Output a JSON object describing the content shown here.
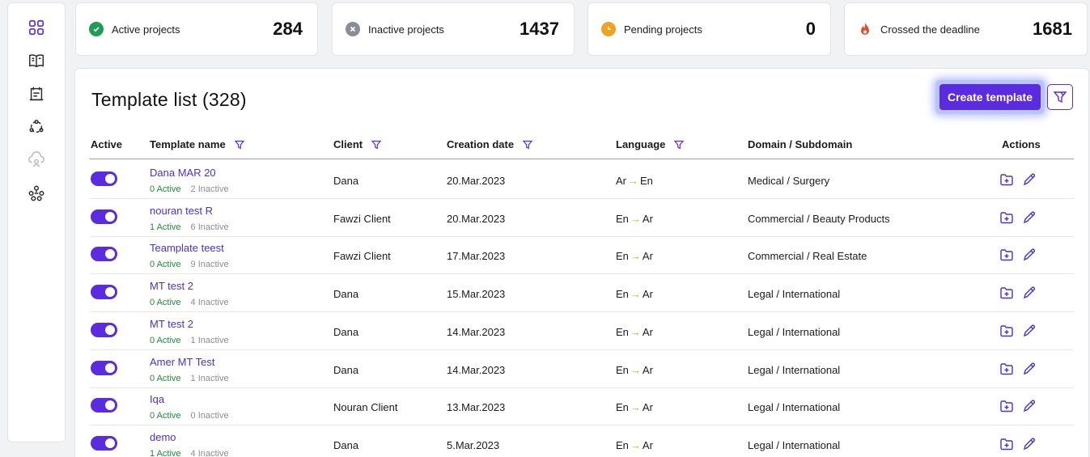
{
  "sidebar": {
    "items": [
      {
        "icon": "dashboard-grid-icon",
        "active": true
      },
      {
        "icon": "book-icon"
      },
      {
        "icon": "calendar-note-icon"
      },
      {
        "icon": "team-circle-icon"
      },
      {
        "icon": "cloud-user-icon",
        "disabled": true
      },
      {
        "icon": "hierarchy-icon"
      }
    ]
  },
  "stats": [
    {
      "label": "Active projects",
      "value": "284",
      "icon": "check-circle-icon",
      "color": "#1f9d55"
    },
    {
      "label": "Inactive projects",
      "value": "1437",
      "icon": "x-circle-icon",
      "color": "#8a8d94"
    },
    {
      "label": "Pending projects",
      "value": "0",
      "icon": "clock-icon",
      "color": "#f0a323"
    },
    {
      "label": "Crossed the deadline",
      "value": "1681",
      "icon": "fire-icon",
      "color": "#e0502a"
    }
  ],
  "panel": {
    "title": "Template list (328)",
    "create_label": "Create template"
  },
  "columns": {
    "active": "Active",
    "template_name": "Template name",
    "client": "Client",
    "creation_date": "Creation date",
    "language": "Language",
    "domain": "Domain / Subdomain",
    "actions": "Actions"
  },
  "rows": [
    {
      "name": "Dana MAR 20",
      "active": "0 Active",
      "inactive": "2 Inactive",
      "client": "Dana",
      "date": "20.Mar.2023",
      "from": "Ar",
      "to": "En",
      "domain": "Medical / Surgery"
    },
    {
      "name": "nouran test R",
      "active": "1 Active",
      "inactive": "6 Inactive",
      "client": "Fawzi Client",
      "date": "20.Mar.2023",
      "from": "En",
      "to": "Ar",
      "domain": "Commercial / Beauty Products"
    },
    {
      "name": "Teamplate teest",
      "active": "0 Active",
      "inactive": "9 Inactive",
      "client": "Fawzi Client",
      "date": "17.Mar.2023",
      "from": "En",
      "to": "Ar",
      "domain": "Commercial / Real Estate"
    },
    {
      "name": "MT test 2",
      "active": "0 Active",
      "inactive": "4 Inactive",
      "client": "Dana",
      "date": "15.Mar.2023",
      "from": "En",
      "to": "Ar",
      "domain": "Legal / International"
    },
    {
      "name": "MT test 2",
      "active": "0 Active",
      "inactive": "1 Inactive",
      "client": "Dana",
      "date": "14.Mar.2023",
      "from": "En",
      "to": "Ar",
      "domain": "Legal / International"
    },
    {
      "name": "Amer MT Test",
      "active": "0 Active",
      "inactive": "1 Inactive",
      "client": "Dana",
      "date": "14.Mar.2023",
      "from": "En",
      "to": "Ar",
      "domain": "Legal / International"
    },
    {
      "name": "Iqa",
      "active": "0 Active",
      "inactive": "0 Inactive",
      "client": "Nouran Client",
      "date": "13.Mar.2023",
      "from": "En",
      "to": "Ar",
      "domain": "Legal / International"
    },
    {
      "name": "demo",
      "active": "1 Active",
      "inactive": "4 Inactive",
      "client": "Dana",
      "date": "5.Mar.2023",
      "from": "En",
      "to": "Ar",
      "domain": "Legal / International"
    }
  ],
  "language_arrow": "→",
  "colors": {
    "accent": "#5b2be0",
    "link": "#4a2fd6",
    "active_green": "#1f8a3a"
  }
}
